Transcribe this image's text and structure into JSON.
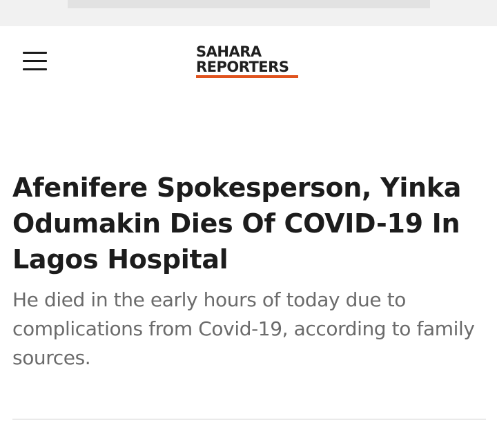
{
  "header": {
    "logo_line1": "SAHARA",
    "logo_line2": "REPORTERS",
    "logo_accent_color": "#e0531e",
    "menu_icon": "hamburger-menu-icon"
  },
  "article": {
    "headline": "Afenifere Spokesperson, Yinka Odumakin Dies Of COVID-19 In Lagos Hospital",
    "summary": "He died in the early hours of today due to complications from Covid-19, according to family sources."
  }
}
